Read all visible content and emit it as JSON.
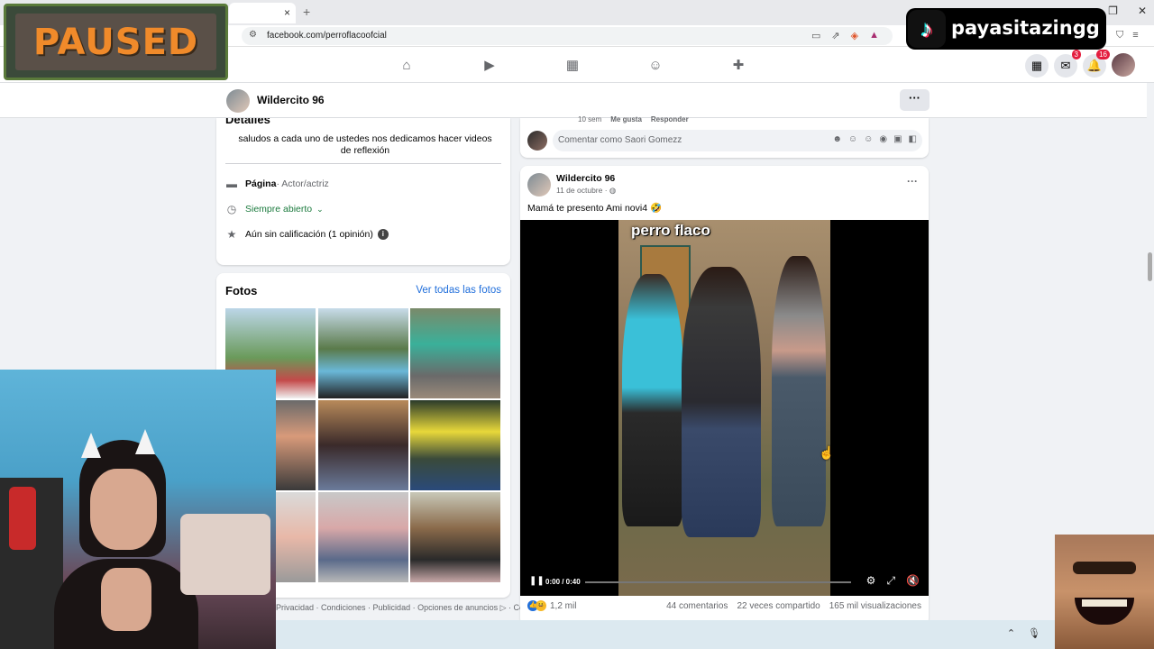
{
  "browser": {
    "tab_close": "×",
    "new_tab": "+",
    "url": "facebook.com/perroflacoofcial",
    "window_controls": [
      "—",
      "❐",
      "✕"
    ]
  },
  "fbnav": {
    "messenger_badge": "3",
    "notifications_badge": "16"
  },
  "page_header": {
    "name": "Wildercito 96",
    "more": "···"
  },
  "details": {
    "title": "Detalles",
    "bio": "saludos a cada uno de ustedes nos dedicamos hacer videos de reflexión",
    "category_label": "Página",
    "category_value": " · Actor/actriz",
    "hours": "Siempre abierto",
    "rating": "Aún sin calificación (1 opinión)"
  },
  "photos": {
    "title": "Fotos",
    "see_all": "Ver todas las fotos"
  },
  "footer": {
    "links": "Privacidad · Condiciones · Publicidad · Opciones de anuncios ▷ · Cookies · Más"
  },
  "comment_bar": {
    "meta_time": "10 sem",
    "meta_like": "Me gusta",
    "meta_reply": "Responder",
    "placeholder": "Comentar como Saori Gomezz"
  },
  "post": {
    "author": "Wildercito 96",
    "date": "11 de octubre · ",
    "text": "Mamá te presento Ami novi4 🤣",
    "more": "···",
    "video_caption": "perro flaco",
    "time": "0:00 / 0:40",
    "progress": 0.0,
    "reactions": "1,2 mil",
    "comments": "44 comentarios",
    "shares": "22 veces compartido",
    "views": "165 mil visualizaciones"
  },
  "overlays": {
    "paused": "PAUSED",
    "tiktok_handle": "payasitazingg"
  },
  "colors": {
    "fb_blue": "#216fdb",
    "badge_red": "#e41e3f",
    "open_green": "#1b7a3d",
    "paused_orange": "#f08a2a"
  }
}
